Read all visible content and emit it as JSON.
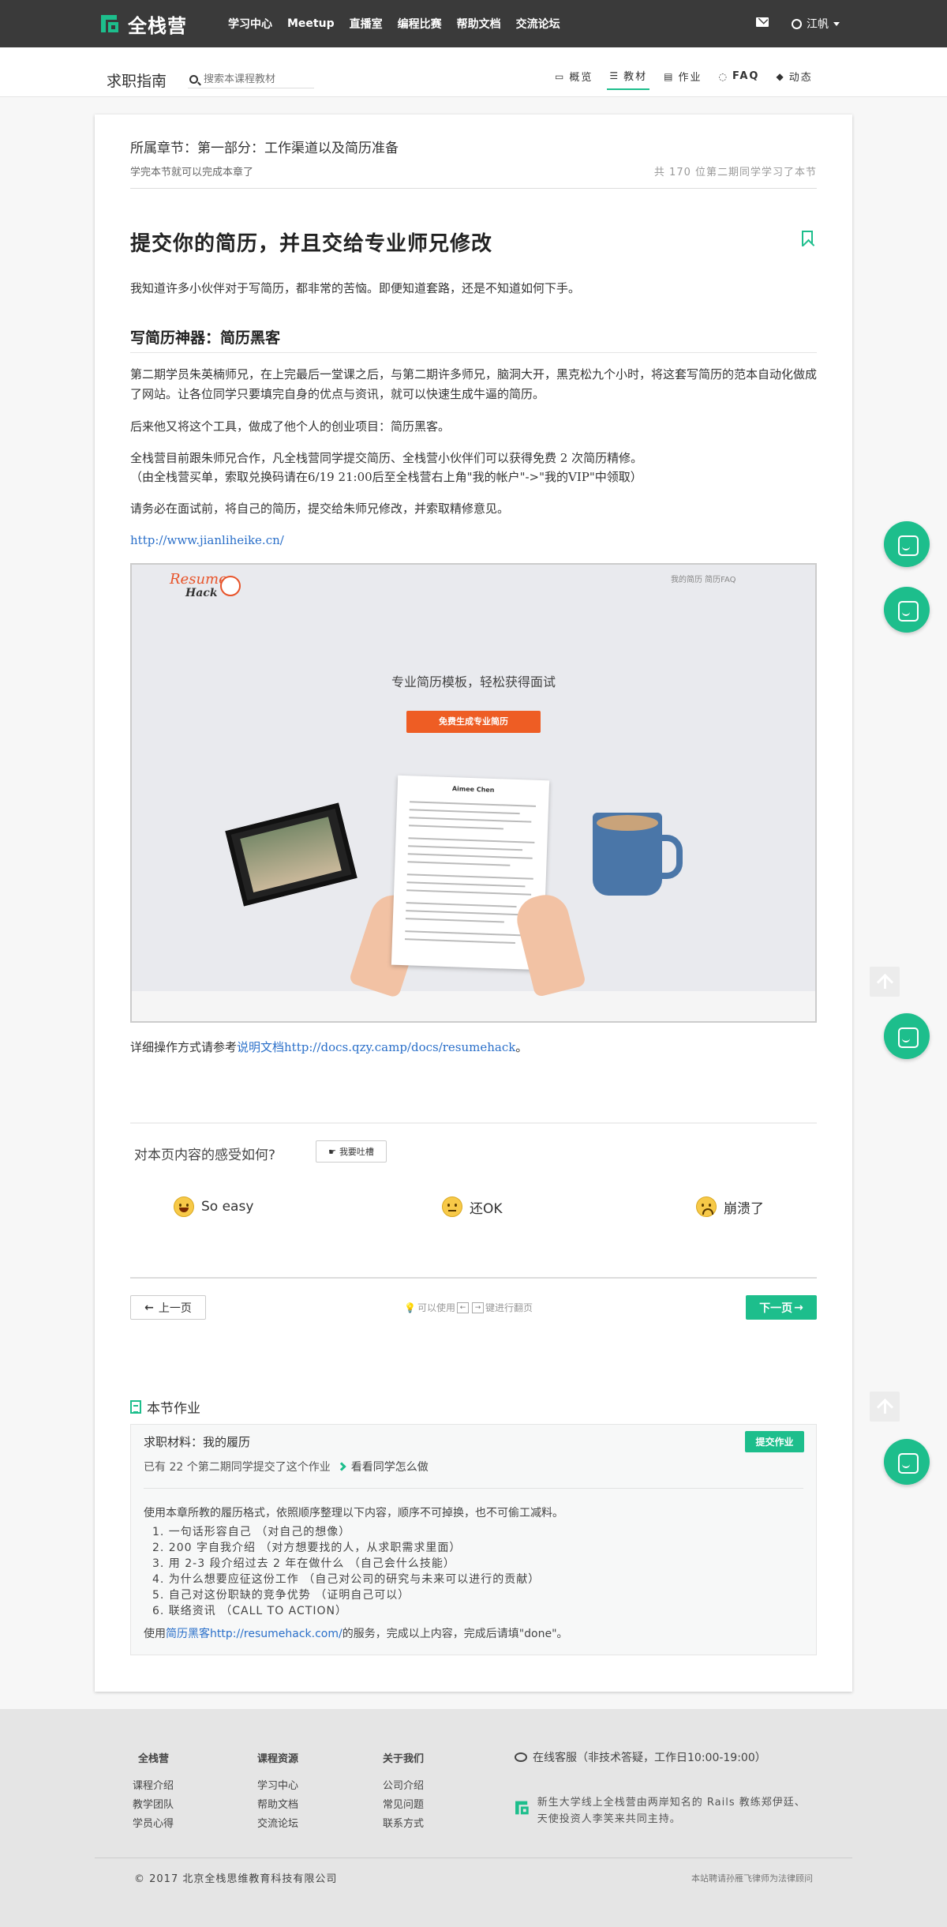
{
  "topnav": {
    "brand": "全栈营",
    "links": [
      "学习中心",
      "Meetup",
      "直播室",
      "编程比赛",
      "帮助文档",
      "交流论坛"
    ],
    "user": "江帆",
    "colors": {
      "bar": "#3a3a3a",
      "accent": "#1dbe8c"
    }
  },
  "subnav": {
    "title": "求职指南",
    "search_placeholder": "搜索本课程教材",
    "tabs": [
      {
        "icon": "monitor-icon",
        "label": "概览"
      },
      {
        "icon": "list-icon",
        "label": "教材",
        "active": true
      },
      {
        "icon": "document-icon",
        "label": "作业"
      },
      {
        "icon": "chat-icon",
        "label": "FAQ"
      },
      {
        "icon": "tag-icon",
        "label": "动态"
      }
    ]
  },
  "chapter": {
    "label": "所属章节：第一部分：工作渠道以及简历准备",
    "sub": "学完本节就可以完成本章了",
    "count": "共 170 位第二期同学学习了本节"
  },
  "article": {
    "title": "提交你的简历，并且交给专业师兄修改",
    "intro": "我知道许多小伙伴对于写简历，都非常的苦恼。即便知道套路，还是不知道如何下手。",
    "h2": "写简历神器：简历黑客",
    "p1": "第二期学员朱英楠师兄，在上完最后一堂课之后，与第二期许多师兄，脑洞大开，黑克松九个小时，将这套写简历的范本自动化做成了网站。让各位同学只要填完自身的优点与资讯，就可以快速生成牛逼的简历。",
    "p2": "后来他又将这个工具，做成了他个人的创业项目：简历黑客。",
    "p3a": "全栈营目前跟朱师兄合作，凡全栈营同学提交简历、全栈营小伙伴们可以获得免费 2 次简历精修。",
    "p3b": "（由全栈营买单，索取兑换码请在6/19 21:00后至全栈营右上角\"我的帐户\"->\"我的VIP\"中领取）",
    "p4": "请务必在面试前，将自己的简历，提交给朱师兄修改，并索取精修意见。",
    "url": "http://www.jianliheike.cn/",
    "detail_prefix": "详细操作方式请参考",
    "detail_link": "说明文档http://docs.qzy.camp/docs/resumehack",
    "detail_suffix": "。"
  },
  "embed": {
    "logo_top": "Resume",
    "logo_bottom": "Hack",
    "links": "我的简历   简历FAQ",
    "slogan": "专业简历模板，轻松获得面试",
    "button": "免费生成专业简历",
    "resume_name": "Aimee Chen"
  },
  "feedback": {
    "question": "对本页内容的感受如何?",
    "button": "我要吐槽",
    "options": [
      "So easy",
      "还OK",
      "崩溃了"
    ]
  },
  "pager": {
    "prev": "上一页",
    "hint_prefix": "可以使用",
    "hint_suffix": "键进行翻页",
    "next": "下一页"
  },
  "homework": {
    "section_title": "本节作业",
    "name": "求职材料：我的履历",
    "submit": "提交作业",
    "count": "已有 22 个第二期同学提交了这个作业",
    "see": "看看同学怎么做",
    "intro": "使用本章所教的履历格式，依照顺序整理以下内容，顺序不可掉换，也不可偷工减料。",
    "items": [
      "1. 一句话形容自己 （对自己的想像）",
      "2. 200 字自我介绍  （对方想要找的人，从求职需求里面）",
      "3. 用 2-3 段介绍过去 2 年在做什么  （自己会什么技能）",
      "4. 为什么想要应征这份工作  （自己对公司的研究与未来可以进行的贡献）",
      "5. 自己对这份职缺的竞争优势  （证明自己可以）",
      "6. 联络资讯  （CALL TO ACTION）"
    ],
    "end_prefix": "使用",
    "end_link": "简历黑客http://resumehack.com/",
    "end_suffix": "的服务，完成以上内容，完成后请填\"done\"。"
  },
  "footer": {
    "cols": [
      {
        "title": "全栈营",
        "items": [
          "课程介绍",
          "教学团队",
          "学员心得"
        ]
      },
      {
        "title": "课程资源",
        "items": [
          "学习中心",
          "帮助文档",
          "交流论坛"
        ]
      },
      {
        "title": "关于我们",
        "items": [
          "公司介绍",
          "常见问题",
          "联系方式"
        ]
      }
    ],
    "support": "在线客服（非技术答疑，工作日10:00-19:00）",
    "intro": "新生大学线上全栈营由两岸知名的 Rails 教练郑伊廷、天使投资人李笑来共同主持。",
    "copyright": "© 2017 北京全栈思维教育科技有限公司",
    "lawyer": "本站聘请孙雁飞律师为法律顾问"
  }
}
